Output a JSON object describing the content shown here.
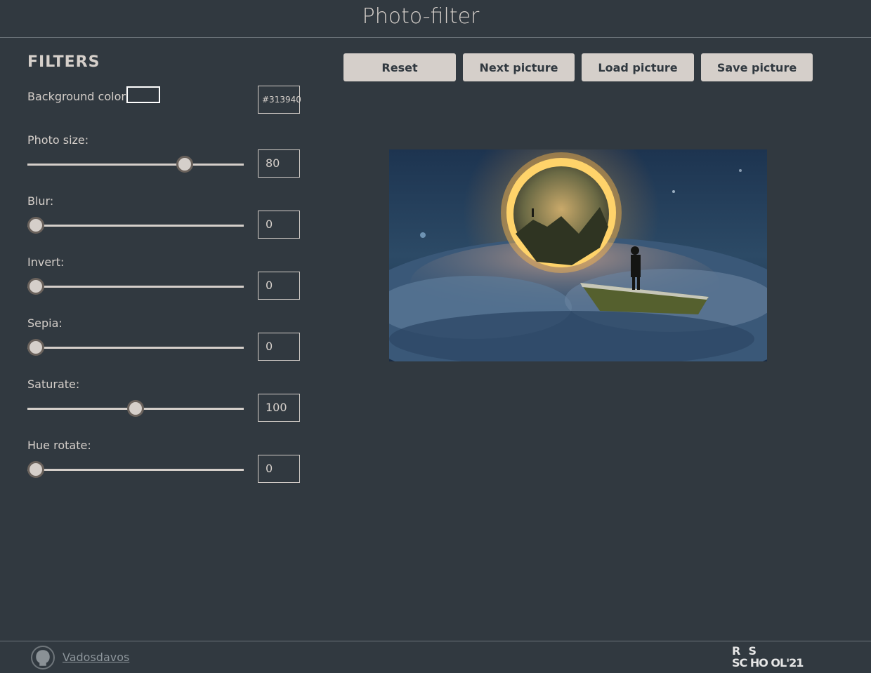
{
  "header": {
    "title": "Photo-filter"
  },
  "filters": {
    "title": "FILTERS",
    "background": {
      "label": "Background color:",
      "value": "#313940",
      "swatch_color": "#313940"
    },
    "items": [
      {
        "label": "Photo size:",
        "value": "80",
        "fraction": 0.73
      },
      {
        "label": "Blur:",
        "value": "0",
        "fraction": 0.0
      },
      {
        "label": "Invert:",
        "value": "0",
        "fraction": 0.0
      },
      {
        "label": "Sepia:",
        "value": "0",
        "fraction": 0.0
      },
      {
        "label": "Saturate:",
        "value": "100",
        "fraction": 0.5
      },
      {
        "label": "Hue rotate:",
        "value": "0",
        "fraction": 0.0
      }
    ]
  },
  "toolbar": {
    "reset_label": "Reset",
    "next_label": "Next picture",
    "load_label": "Load picture",
    "save_label": "Save picture"
  },
  "footer": {
    "author_link": "Vadosdavos",
    "logo_text_top": "R  S",
    "logo_text_bottom": "SC HO OL'21"
  },
  "colors": {
    "background": "#313940",
    "accent": "#d5cfca",
    "button_text": "#313940"
  },
  "icons": {
    "github": "github-icon",
    "logo": "rs-school-logo"
  }
}
